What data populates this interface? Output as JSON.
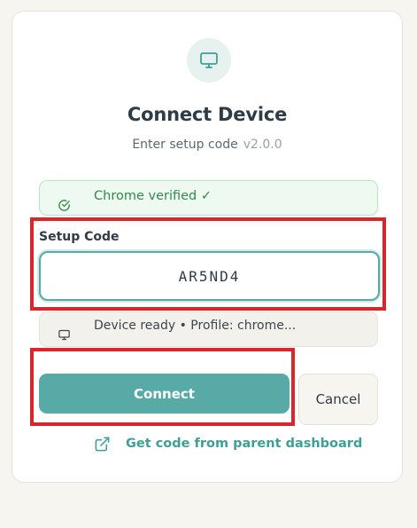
{
  "header": {
    "icon": "monitor-icon",
    "title": "Connect Device",
    "subtitle": "Enter setup code",
    "version": "v2.0.0"
  },
  "status": {
    "verified_text": "Chrome verified ✓",
    "verified_icon": "check-circle-icon"
  },
  "form": {
    "setup_code_label": "Setup Code",
    "setup_code_value": "AR5ND4"
  },
  "device": {
    "icon": "monitor-icon",
    "status_text": "Device ready • Profile: chrome..."
  },
  "actions": {
    "connect_label": "Connect",
    "cancel_label": "Cancel",
    "parent_link_label": "Get code from parent dashboard",
    "parent_link_icon": "external-link-icon"
  },
  "colors": {
    "accent": "#57aaa6",
    "success": "#2f8a4b",
    "highlight": "#d9262a"
  }
}
